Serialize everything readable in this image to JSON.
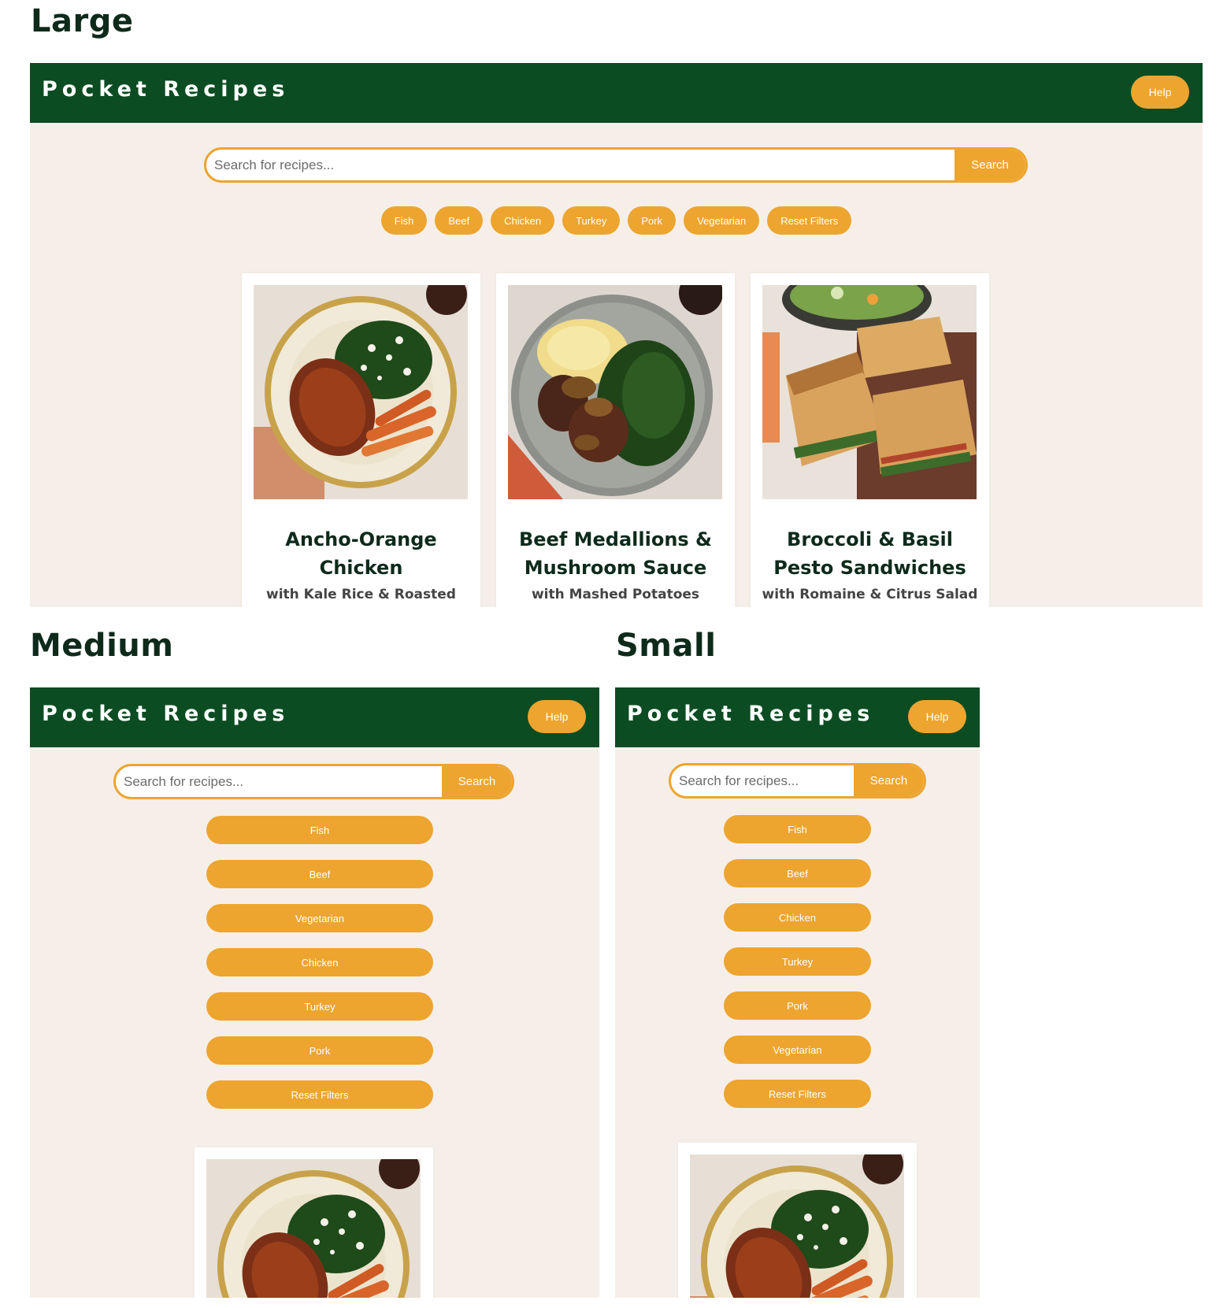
{
  "sections": {
    "large": "Large",
    "medium": "Medium",
    "small": "Small"
  },
  "app": {
    "brand": "Pocket Recipes",
    "help_label": "Help",
    "search_placeholder": "Search for recipes...",
    "search_label": "Search"
  },
  "filters_large": [
    "Fish",
    "Beef",
    "Chicken",
    "Turkey",
    "Pork",
    "Vegetarian",
    "Reset Filters"
  ],
  "filters_medium": [
    "Fish",
    "Beef",
    "Vegetarian",
    "Chicken",
    "Turkey",
    "Pork",
    "Reset Filters"
  ],
  "filters_small": [
    "Fish",
    "Beef",
    "Chicken",
    "Turkey",
    "Pork",
    "Vegetarian",
    "Reset Filters"
  ],
  "recipes": [
    {
      "title": "Ancho-Orange Chicken",
      "subtitle": "with Kale Rice & Roasted",
      "image": "chicken-kale-plate"
    },
    {
      "title": "Beef Medallions & Mushroom Sauce",
      "subtitle": "with Mashed Potatoes",
      "image": "beef-mushroom-plate"
    },
    {
      "title": "Broccoli & Basil Pesto Sandwiches",
      "subtitle": "with Romaine & Citrus Salad",
      "image": "pesto-sandwich-board"
    }
  ],
  "colors": {
    "header_green": "#0c4c23",
    "accent_orange": "#eda52f",
    "page_bg": "#f6efe9",
    "heading_text": "#0e2a1b"
  }
}
